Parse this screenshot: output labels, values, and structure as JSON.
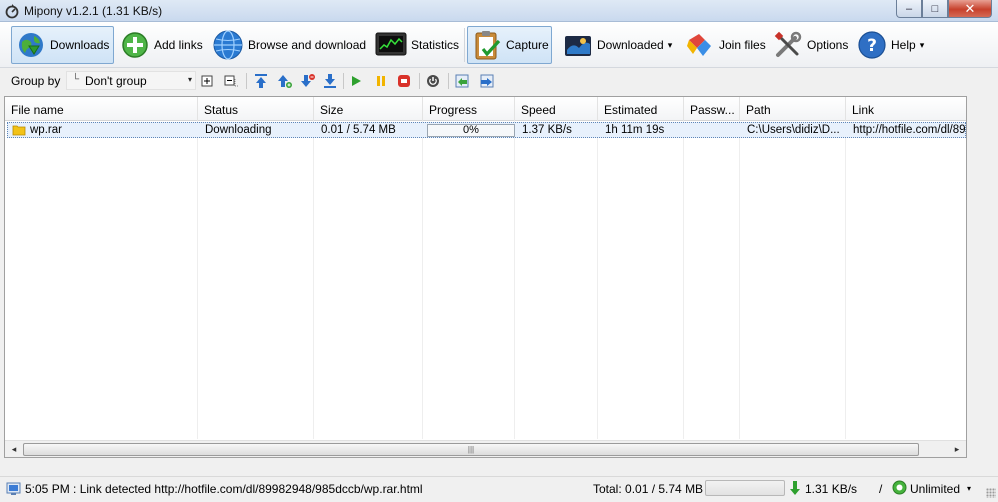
{
  "window": {
    "title": "Mipony v1.2.1 (1.31 KB/s)",
    "minimize_glyph": "–",
    "maximize_glyph": "□",
    "close_glyph": "✕"
  },
  "toolbar": {
    "downloads": "Downloads",
    "add_links": "Add links",
    "browse": "Browse and download",
    "statistics": "Statistics",
    "capture": "Capture",
    "downloaded": "Downloaded",
    "join_files": "Join files",
    "options": "Options",
    "help": "Help",
    "dropdown_glyph": "▾"
  },
  "toolbar2": {
    "group_by_label": "Group by",
    "group_by_value": "Don't group",
    "tree_glyph": "└",
    "dropdown_glyph": "▾"
  },
  "list": {
    "columns": [
      "File name",
      "Status",
      "Size",
      "Progress",
      "Speed",
      "Estimated",
      "Passw...",
      "Path",
      "Link"
    ],
    "rows": [
      {
        "file_name": "wp.rar",
        "status": "Downloading",
        "size": "0.01 / 5.74 MB",
        "progress": "0%",
        "progress_fraction": 0.0,
        "speed": "1.37 KB/s",
        "estimated": "1h 11m 19s",
        "password": "",
        "path": "C:\\Users\\didiz\\D...",
        "link": "http://hotfile.com/dl/89"
      }
    ],
    "scroll_left_glyph": "◂",
    "scroll_right_glyph": "▸",
    "scroll_thumb_grip": "|||"
  },
  "statusbar": {
    "message": "5:05 PM : Link detected http://hotfile.com/dl/89982948/985dccb/wp.rar.html",
    "total": "Total: 0.01 / 5.74 MB",
    "total_progress_fraction": 0.0,
    "speed": "1.31 KB/s",
    "separator": "/",
    "limit": "Unlimited",
    "dropdown_glyph": "▾"
  },
  "colors": {
    "accent": "#3a7bd5",
    "selected_row": "#e8f1fc",
    "green": "#3aa33a",
    "red": "#d9322a",
    "yellow": "#f2b400"
  }
}
